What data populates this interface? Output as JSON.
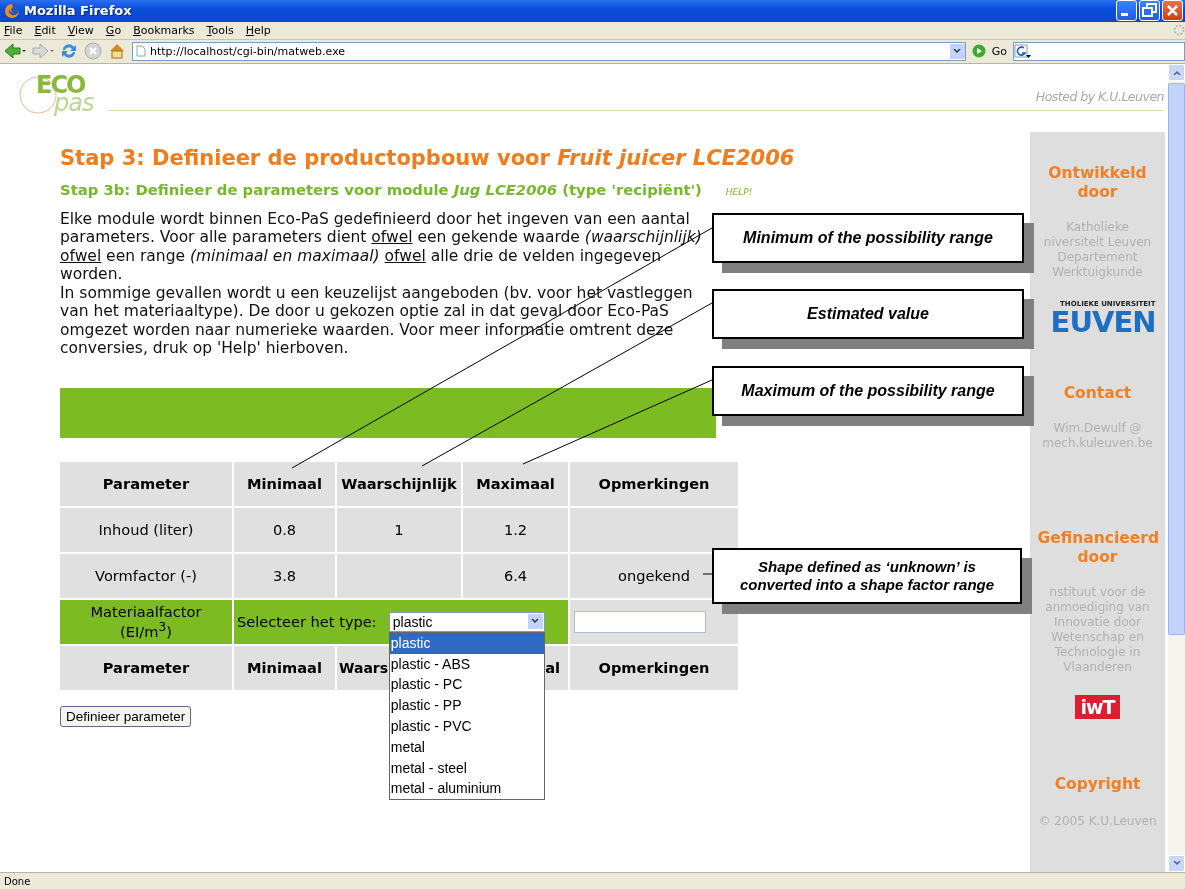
{
  "window": {
    "title": "Mozilla Firefox"
  },
  "menu": [
    "File",
    "Edit",
    "View",
    "Go",
    "Bookmarks",
    "Tools",
    "Help"
  ],
  "toolbar": {
    "url": "http://localhost/cgi-bin/matweb.exe",
    "go_label": "Go"
  },
  "header": {
    "logo_top": "ECO",
    "logo_bottom": "pas",
    "hosted": "Hosted by K.U.Leuven"
  },
  "title": "Stap 3: Definieer de productopbouw voor *Fruit juicer LCE2006*",
  "subtitle": "Stap 3b: Definieer de parameters voor module *Jug LCE2006* (type 'recipiënt')",
  "help": "HELP!",
  "intro": [
    {
      "segments": [
        {
          "kind": "plain",
          "text": "Elke module wordt binnen Eco-PaS gedefinieerd door het ingeven van een aantal parameters. Voor alle parameters dient "
        },
        {
          "kind": "underline",
          "text": "ofwel"
        },
        {
          "kind": "plain",
          "text": " een gekende waarde "
        },
        {
          "kind": "italic",
          "text": "(waarschijnlijk) "
        },
        {
          "kind": "underline",
          "text": "ofwel"
        },
        {
          "kind": "plain",
          "text": " een range "
        },
        {
          "kind": "italic",
          "text": "(minimaal en maximaal) "
        },
        {
          "kind": "underline",
          "text": "ofwel"
        },
        {
          "kind": "plain",
          "text": " alle drie de velden ingegeven worden."
        }
      ]
    },
    {
      "segments": [
        {
          "kind": "plain",
          "text": "In sommige gevallen wordt u een keuzelijst aangeboden (bv. voor het vastleggen van het materiaaltype). De door u gekozen optie zal in dat geval door Eco-PaS omgezet worden naar numerieke waarden. Voor meer informatie omtrent deze conversies, druk op 'Help' hierboven."
        }
      ]
    }
  ],
  "table": {
    "columns": [
      "Parameter",
      "Minimaal",
      "Waarschijnlijk",
      "Maximaal",
      "Opmerkingen"
    ],
    "rows": [
      {
        "kind": "values",
        "parameter": "Inhoud (liter)",
        "minimaal": "0.8",
        "waarschijnlijk": "1",
        "maximaal": "1.2"
      },
      {
        "kind": "values",
        "parameter": "Vormfactor (-)",
        "minimaal": "3.8",
        "maximaal": "6.4",
        "opmerkingen": "ongekend"
      },
      {
        "kind": "select",
        "parameter": "Materiaalfactor (EI/m$^{3}$)",
        "prompt": "Selecteer het type:",
        "value": "plastic"
      },
      {
        "kind": "header",
        "cells": [
          "Parameter",
          "Minimaal",
          "Waars",
          "al",
          "Opmerkingen"
        ]
      }
    ]
  },
  "dropdown": {
    "options": [
      {
        "label": "plastic",
        "selected": true
      },
      {
        "label": "plastic - ABS",
        "selected": false
      },
      {
        "label": "plastic - PC",
        "selected": false
      },
      {
        "label": "plastic - PP",
        "selected": false
      },
      {
        "label": "plastic - PVC",
        "selected": false
      },
      {
        "label": "metal",
        "selected": false
      },
      {
        "label": "metal - steel",
        "selected": false
      },
      {
        "label": "metal - aluminium",
        "selected": false
      }
    ]
  },
  "button": "Definieer parameter",
  "callouts": [
    "Minimum of the possibility range",
    "Estimated value",
    "Maximum of the possibility range",
    "Shape defined as ‘unknown’ is converted into a shape factor range"
  ],
  "sidebar": [
    {
      "heading": "Ontwikkeld door",
      "lines": [
        "Katholieke",
        "niversiteit Leuven",
        "Departement",
        "Werktuigkunde"
      ],
      "logo": {
        "kind": "leuven",
        "top": "THOLIEKE UNIVERSITEIT",
        "bottom": "EUVEN"
      }
    },
    {
      "heading": "Contact",
      "lines": [
        "Wim.Dewulf @",
        "mech.kuleuven.be"
      ]
    },
    {
      "heading": "Gefinancieerd door",
      "lines": [
        "nstituut voor de",
        "anmoediging van",
        "Innovatie door",
        "Wetenschap en",
        "Technologie in",
        "Vlaanderen"
      ],
      "logo": {
        "kind": "iwt",
        "text": "iwT"
      }
    },
    {
      "heading": "Copyright",
      "lines": [
        "© 2005 K.U.Leuven"
      ]
    }
  ],
  "status_bar": "Done"
}
